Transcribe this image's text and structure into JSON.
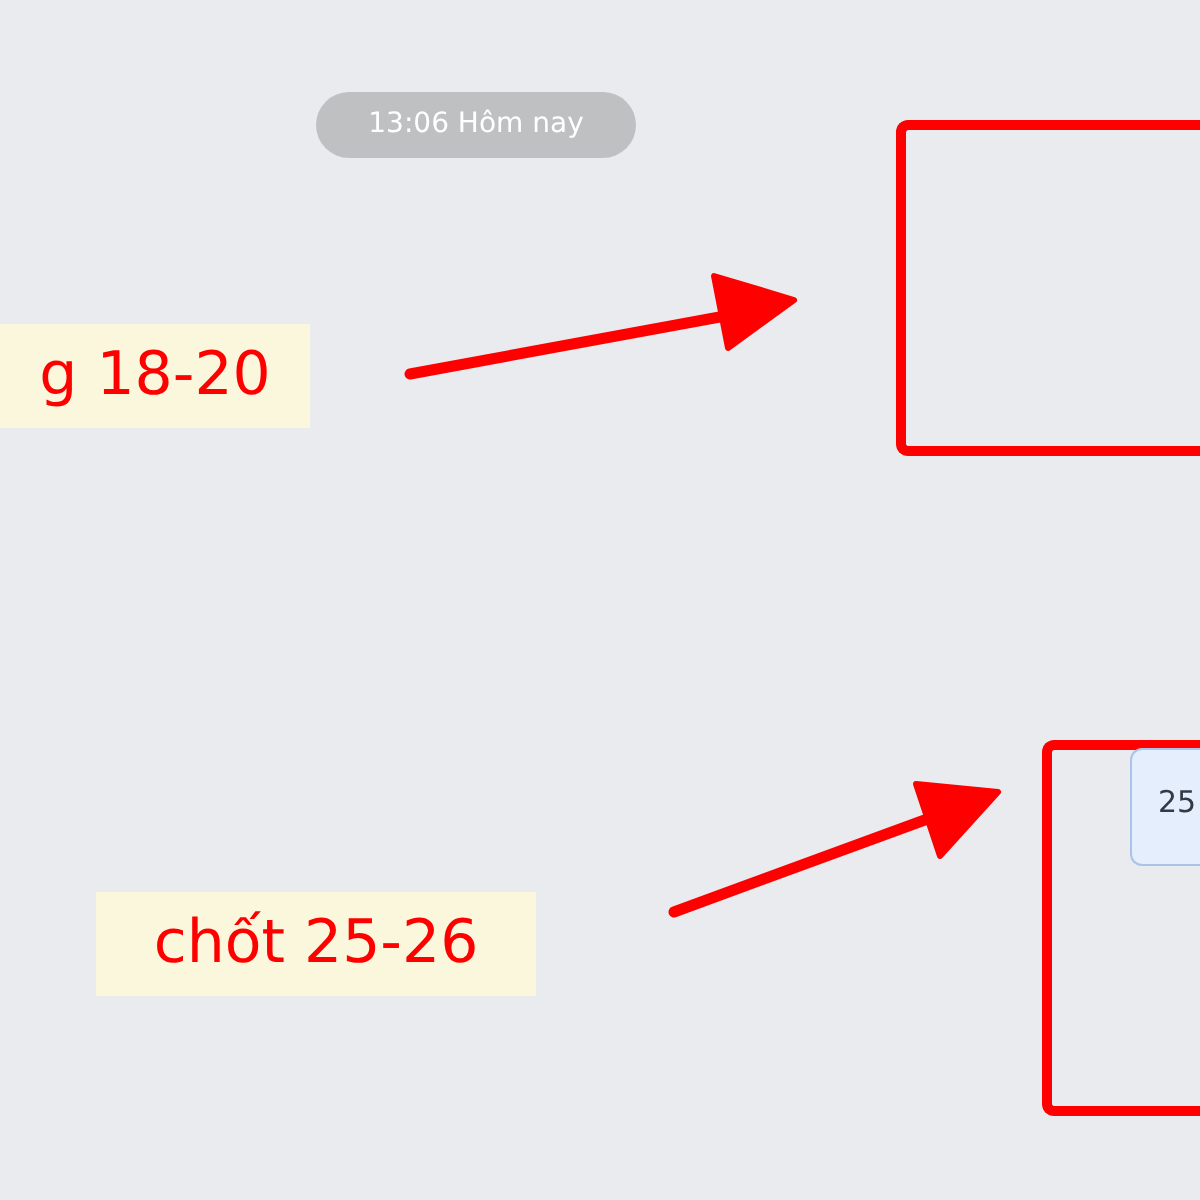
{
  "chat": {
    "timestamp": "13:06 Hôm nay",
    "messages": [
      {
        "text": "25"
      }
    ]
  },
  "callouts": [
    {
      "label": "g 18-20"
    },
    {
      "label": "chốt 25-26"
    }
  ]
}
